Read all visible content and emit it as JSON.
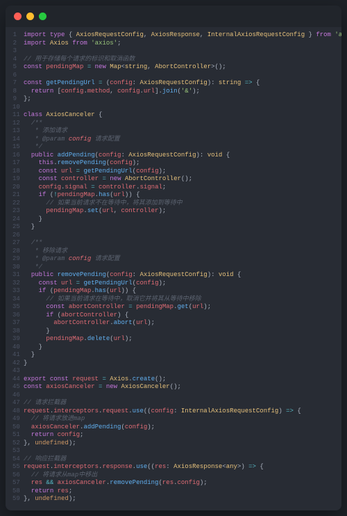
{
  "titlebar": {
    "dots": [
      "red",
      "yellow",
      "green"
    ]
  },
  "comments": {
    "c1": "// 用于存储每个请求的标识和取消函数",
    "c2": "/**",
    "c3": " * 添加请求",
    "c4": " * @param ",
    "c4b": " 请求配置",
    "c5": " */",
    "c6": "// 如果当前请求不在等待中，将其添加到等待中",
    "c7": " * 移除请求",
    "c8": "// 如果当前请求在等待中，取消它并将其从等待中移除",
    "c9": "// 请求拦截器",
    "c10": "// 将请求放进map",
    "c11": "// 响应拦截器",
    "c12": "// 将请求从map中移出"
  },
  "strings": {
    "axios": "'axios'",
    "amp": "'&'"
  },
  "idents": {
    "AxiosRequestConfig": "AxiosRequestConfig",
    "AxiosResponse": "AxiosResponse",
    "InternalAxiosRequestConfig": "InternalAxiosRequestConfig",
    "Axios": "Axios",
    "pendingMap": "pendingMap",
    "Map": "Map",
    "string": "string",
    "AbortController": "AbortController",
    "getPendingUrl": "getPendingUrl",
    "config": "config",
    "method": "method",
    "url": "url",
    "join": "join",
    "AxiosCanceler": "AxiosCanceler",
    "addPending": "addPending",
    "void": "void",
    "removePending": "removePending",
    "controller": "controller",
    "signal": "signal",
    "has": "has",
    "set": "set",
    "get": "get",
    "abortController": "abortController",
    "abort": "abort",
    "delete": "delete",
    "request": "request",
    "create": "create",
    "axiosCanceler": "axiosCanceler",
    "interceptors": "interceptors",
    "response": "response",
    "use": "use",
    "res": "res",
    "any": "any",
    "undefined": "undefined"
  },
  "kw": {
    "import": "import",
    "type": "type",
    "from": "from",
    "const": "const",
    "new": "new",
    "return": "return",
    "class": "class",
    "public": "public",
    "this": "this",
    "if": "if",
    "export": "export"
  },
  "tokens": {
    "arrow": "=>",
    "bang": "!",
    "and": "&&",
    "assign": "="
  }
}
